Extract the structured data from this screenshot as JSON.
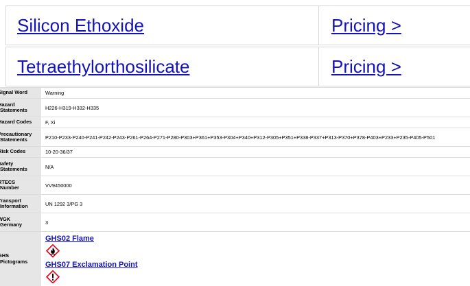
{
  "products": [
    {
      "name": "Silicon Ethoxide",
      "pricing": "Pricing >"
    },
    {
      "name": "Tetraethylorthosilicate",
      "pricing": "Pricing >"
    }
  ],
  "safety": {
    "signal_word": {
      "label": "Signal Word",
      "value": "Warning"
    },
    "hazard_statements": {
      "label": "Hazard\nStatements",
      "value": "H226-H319-H332-H335"
    },
    "hazard_codes": {
      "label": "Hazard Codes",
      "value": "F, Xi"
    },
    "precautionary_statements": {
      "label": "Precautionary\nStatements",
      "value": "P210-P233-P240-P241-P242-P243-P261-P264-P271-P280-P303+P361+P353-P304+P340+P312-P305+P351+P338-P337+P313-P370+P378-P403+P233+P235-P405-P501"
    },
    "risk_codes": {
      "label": "Risk Codes",
      "value": "10-20-36/37"
    },
    "safety_statements": {
      "label": "Safety\nStatements",
      "value": "N/A"
    },
    "rtecs_number": {
      "label": "RTECS\nNumber",
      "value": "VV9450000"
    },
    "transport_information": {
      "label": "Transport\nInformation",
      "value": "UN 1292 3/PG 3"
    },
    "wgk_germany": {
      "label": "WGK\nGermany",
      "value": "3"
    },
    "ghs_pictograms": {
      "label": "GHS\nPictograms",
      "items": [
        {
          "name": "GHS02 Flame",
          "icon": "flame-icon"
        },
        {
          "name": "GHS07 Exclamation Point",
          "icon": "exclamation-icon"
        }
      ]
    }
  },
  "colors": {
    "link": "#1313b9",
    "label_bg": "#e6e6e6",
    "pictogram": "#e3001b"
  }
}
